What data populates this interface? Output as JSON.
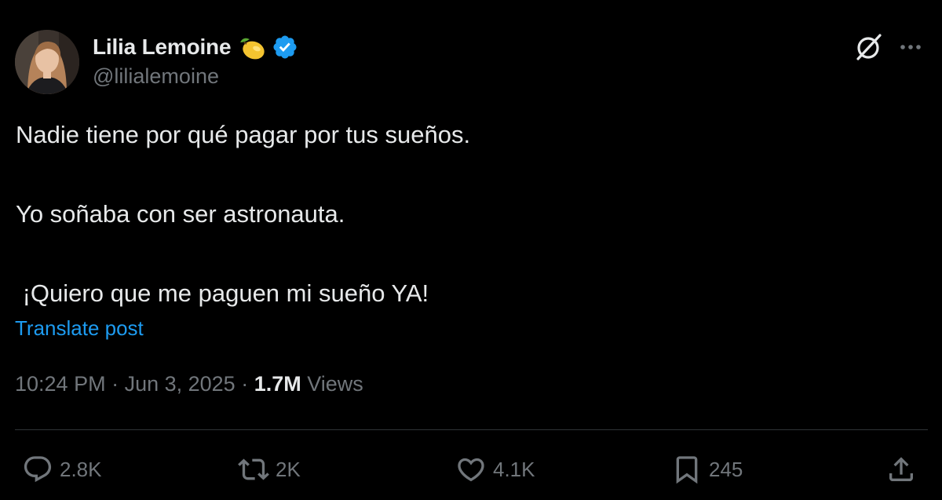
{
  "author": {
    "display_name": "Lilia Lemoine",
    "handle": "@lilialemoine",
    "emoji": "lemon-icon",
    "verified": "verified-badge-icon"
  },
  "header_actions": {
    "grok": "grok-icon",
    "more": "more-icon"
  },
  "post": {
    "lines": [
      "Nadie tiene por qué pagar por tus sueños.",
      "Yo soñaba con ser astronauta.",
      " ¡Quiero que me paguen mi sueño YA!"
    ],
    "translate_label": "Translate post"
  },
  "meta": {
    "time": "10:24 PM",
    "separator": " · ",
    "date": "Jun 3, 2025",
    "views_count": "1.7M",
    "views_label": "Views"
  },
  "actions": {
    "replies": "2.8K",
    "reposts": "2K",
    "likes": "4.1K",
    "bookmarks": "245"
  },
  "colors": {
    "background": "#000000",
    "text": "#e7e9ea",
    "muted": "#71767b",
    "accent": "#1d9bf0",
    "divider": "#2f3336"
  }
}
